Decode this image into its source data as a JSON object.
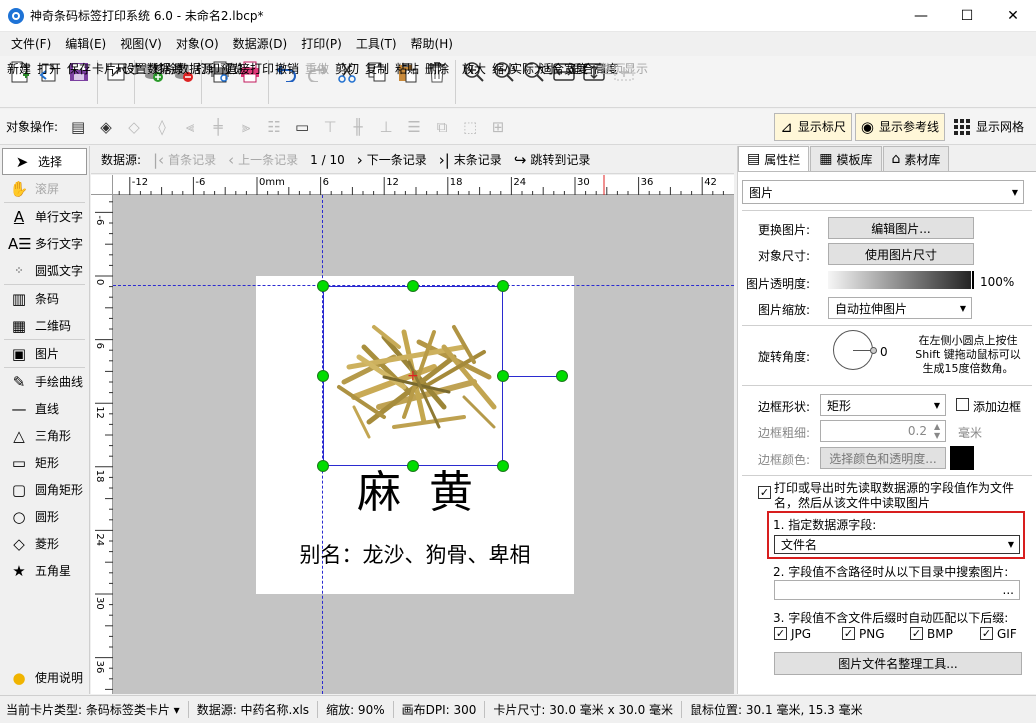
{
  "window": {
    "title": "神奇条码标签打印系统 6.0 - 未命名2.lbcp*",
    "minimize": "—",
    "maximize": "☐",
    "close": "✕"
  },
  "menu": [
    "文件(F)",
    "编辑(E)",
    "视图(V)",
    "对象(O)",
    "数据源(D)",
    "打印(P)",
    "工具(T)",
    "帮助(H)"
  ],
  "toolbar": {
    "new": "新建",
    "open": "打开",
    "save": "保存",
    "card_size": "卡片尺寸",
    "set_datasource": "设置数据源",
    "remove_datasource": "移除数据源",
    "print_preview": "打印预览",
    "direct_print": "直接打印",
    "undo": "撤销",
    "redo": "重做",
    "cut": "剪切",
    "copy": "复制",
    "paste": "粘贴",
    "delete": "删除",
    "zoom_in": "放大",
    "zoom_out": "缩小",
    "actual_size": "实际大小",
    "fit_width": "适合宽度",
    "fit_height": "适合高度",
    "full_page": "整页显示"
  },
  "objbar": {
    "label": "对象操作:",
    "show_ruler": "显示标尺",
    "show_guides": "显示参考线",
    "show_grid": "显示网格"
  },
  "tools": {
    "select": "选择",
    "scroll": "滚屏",
    "single_text": "单行文字",
    "multi_text": "多行文字",
    "arc_text": "圆弧文字",
    "barcode": "条码",
    "qrcode": "二维码",
    "image": "图片",
    "freehand": "手绘曲线",
    "line": "直线",
    "triangle": "三角形",
    "rect": "矩形",
    "round_rect": "圆角矩形",
    "circle": "圆形",
    "diamond": "菱形",
    "star": "五角星",
    "help": "使用说明"
  },
  "records": {
    "label": "数据源:",
    "first": "首条记录",
    "prev": "上一条记录",
    "position": "1 / 10",
    "next": "下一条记录",
    "last": "末条记录",
    "jump": "跳转到记录"
  },
  "ruler": {
    "top_ticks": [
      "-12",
      "-6",
      "0mm",
      "6",
      "12",
      "18",
      "24",
      "30",
      "36",
      "42"
    ],
    "left_ticks": [
      "-6",
      "0",
      "6",
      "12",
      "18",
      "24",
      "30",
      "36"
    ]
  },
  "label_card": {
    "title": "麻  黄",
    "alias": "别名：龙沙、狗骨、卑相"
  },
  "right_panel": {
    "tabs": [
      "属性栏",
      "模板库",
      "素材库"
    ],
    "object_type": "图片",
    "change_image_label": "更换图片:",
    "edit_image_btn": "编辑图片...",
    "object_size_label": "对象尺寸:",
    "use_image_size_btn": "使用图片尺寸",
    "opacity_label": "图片透明度:",
    "opacity_value": "100%",
    "opacity_fraction": 1.0,
    "scale_label": "图片缩放:",
    "scale_value": "自动拉伸图片",
    "rotation_label": "旋转角度:",
    "rotation_value": "0",
    "rotation_hint": "在左侧小圆点上按住 Shift 键拖动鼠标可以生成15度倍数角。",
    "border_shape_label": "边框形状:",
    "border_shape_value": "矩形",
    "add_border_label": "添加边框",
    "border_width_label": "边框粗细:",
    "border_width_value": "0.2",
    "border_width_unit": "毫米",
    "border_color_label": "边框颜色:",
    "border_color_btn": "选择颜色和透明度...",
    "datasource_check_label": "打印或导出时先读取数据源的字段值作为文件名，然后从该文件中读取图片",
    "step1_label": "1. 指定数据源字段:",
    "step1_value": "文件名",
    "step2_label": "2. 字段值不含路径时从以下目录中搜索图片:",
    "browse_btn": "...",
    "step3_label": "3. 字段值不含文件后缀时自动匹配以下后缀:",
    "ext_jpg": "JPG",
    "ext_png": "PNG",
    "ext_bmp": "BMP",
    "ext_gif": "GIF",
    "organize_btn": "图片文件名整理工具..."
  },
  "status": {
    "card_type": "当前卡片类型: 条码标签类卡片 ▾",
    "datasource": "数据源: 中药名称.xls",
    "zoom": "缩放: 90%",
    "dpi": "画布DPI: 300",
    "card_size": "卡片尺寸: 30.0 毫米 x 30.0 毫米",
    "mouse_pos": "鼠标位置: 30.1 毫米, 15.3 毫米"
  },
  "colors": {
    "handle_green": "#00dd00",
    "guide_blue": "#2b2bd0",
    "highlight_red": "#d81e1e"
  }
}
